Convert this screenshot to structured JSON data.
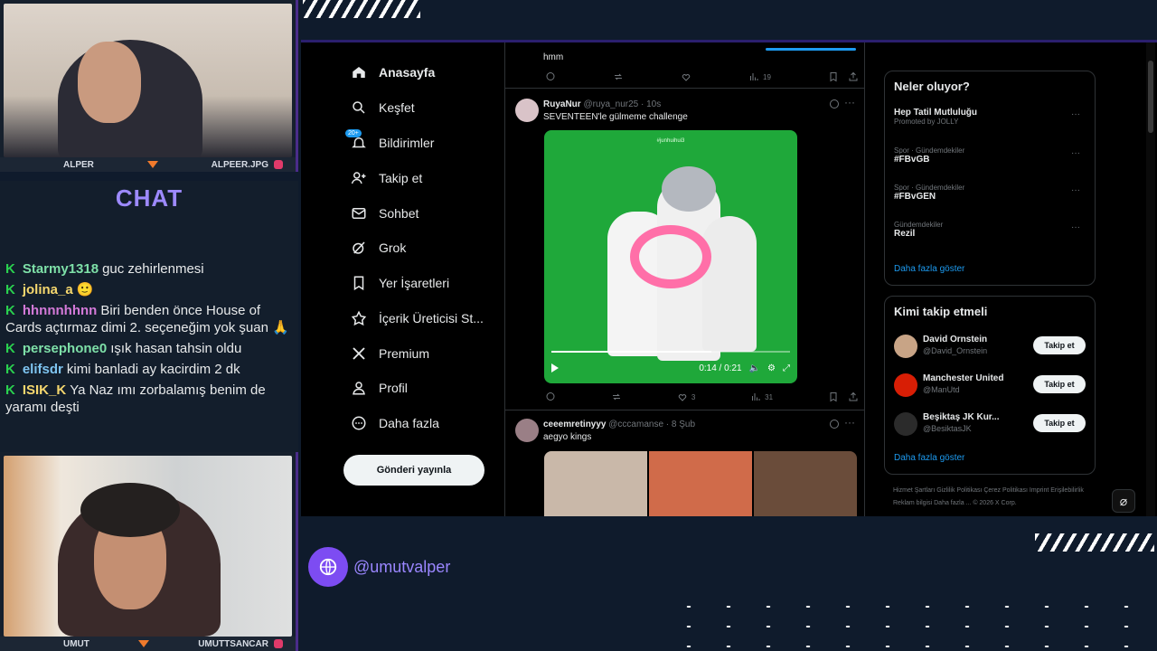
{
  "overlay": {
    "cam_top_left": "ALPER",
    "cam_top_right": "ALPEER.JPG",
    "cam_bottom_left": "UMUT",
    "cam_bottom_right": "UMUTTSANCAR",
    "chat_title": "CHAT",
    "handle": "@umutvalper",
    "accent_color": "#7d4cf2"
  },
  "chat": [
    {
      "badge": "K",
      "user": "Starmy1318",
      "user_color": "#7ee0a8",
      "text": "guc zehirlenmesi"
    },
    {
      "badge": "K",
      "user": "jolina_a",
      "user_color": "#f5d76e",
      "text": "🙂"
    },
    {
      "badge": "K",
      "user": "hhnnnhhnn",
      "user_color": "#d47ad9",
      "text": "Biri benden önce House of Cards açtırmaz dimi 2. seçeneğim yok şuan 🙏"
    },
    {
      "badge": "K",
      "user": "persephone0",
      "user_color": "#7ee0a8",
      "text": "ışık hasan tahsin oldu"
    },
    {
      "badge": "K",
      "user": "elifsdr",
      "user_color": "#7ec4f0",
      "text": "kimi banladi ay kacirdim 2 dk"
    },
    {
      "badge": "K",
      "user": "ISIK_K",
      "user_color": "#f5d76e",
      "text": "Ya Naz ımı zorbalamış benim de yaramı deşti"
    }
  ],
  "nav": {
    "items": [
      {
        "label": "Anasayfa",
        "icon": "home-icon"
      },
      {
        "label": "Keşfet",
        "icon": "search-icon"
      },
      {
        "label": "Bildirimler",
        "icon": "bell-icon",
        "badge": "20+"
      },
      {
        "label": "Takip et",
        "icon": "add-user-icon"
      },
      {
        "label": "Sohbet",
        "icon": "mail-icon"
      },
      {
        "label": "Grok",
        "icon": "grok-icon"
      },
      {
        "label": "Yer İşaretleri",
        "icon": "bookmark-icon"
      },
      {
        "label": "İçerik Üreticisi St...",
        "icon": "creator-icon"
      },
      {
        "label": "Premium",
        "icon": "x-logo-icon"
      },
      {
        "label": "Profil",
        "icon": "profile-icon"
      },
      {
        "label": "Daha fazla",
        "icon": "more-circle-icon"
      }
    ],
    "post_button": "Gönderi yayınla"
  },
  "feed": {
    "prev_tweet_text": "hmm",
    "prev_views": "19",
    "tweet1": {
      "name": "RuyaNur",
      "handle_time": "@ruya_nur25 · 10s",
      "text": "SEVENTEEN'le gülmeme challenge",
      "video_tag": "#junhuihui3",
      "video_time": "0:14 / 0:21",
      "video_progress": 0.67,
      "likes": "3",
      "views": "31"
    },
    "tweet2": {
      "name": "ceeemretinyyy",
      "handle_time": "@cccamanse · 8 Şub",
      "text": "aegyo kings"
    }
  },
  "rail": {
    "trends_title": "Neler oluyor?",
    "trends": [
      {
        "cat": "",
        "topic": "Hep Tatil Mutluluğu",
        "sub": "Promoted by JOLLY"
      },
      {
        "cat": "Spor · Gündemdekiler",
        "topic": "#FBvGB",
        "sub": ""
      },
      {
        "cat": "Spor · Gündemdekiler",
        "topic": "#FBvGEN",
        "sub": ""
      },
      {
        "cat": "Gündemdekiler",
        "topic": "Rezil",
        "sub": ""
      }
    ],
    "show_more": "Daha fazla göster",
    "follow_title": "Kimi takip etmeli",
    "follow": [
      {
        "name": "David Ornstein",
        "handle": "@David_Ornstein",
        "button": "Takip et"
      },
      {
        "name": "Manchester United",
        "handle": "@ManUtd",
        "button": "Takip et"
      },
      {
        "name": "Beşiktaş JK Kur...",
        "handle": "@BesiktasJK",
        "button": "Takip et"
      }
    ],
    "show_more2": "Daha fazla göster",
    "footer": "Hizmet Şartları   Gizlilik Politikası   Çerez Politikası   Imprint   Erişilebilirlik   Reklam bilgisi   Daha fazla ...   © 2026 X Corp."
  }
}
